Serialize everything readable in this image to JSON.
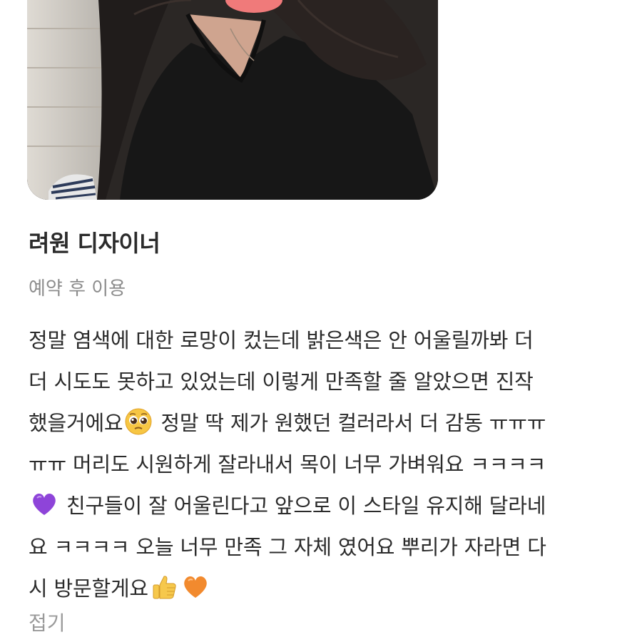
{
  "designer": {
    "name": "려원 디자이너",
    "visit_type": "예약 후 이용"
  },
  "review": {
    "lines": [
      "정말 염색에 대한 로망이 컸는데 밝은색은 안 어울릴까봐 더",
      "더 시도도 못하고 있었는데 이렇게 만족할 줄 알았으면 진작",
      [
        "했을거에요",
        " 정말 딱 제가 원했던 컬러라서 더 감동 ㅠㅠㅠ"
      ],
      "ㅠㅠ 머리도 시원하게 잘라내서 목이 너무 가벼워요 ㅋㅋㅋㅋ",
      " 친구들이 잘 어울린다고 앞으로 이 스타일 유지해 달라네",
      "요 ㅋㅋㅋㅋ 오늘 너무 만족 그 자체 였어요 뿌리가 자라면 다",
      "시 방문할게요"
    ],
    "emojis": [
      "pleading-face-icon",
      "purple-heart-icon",
      "thumbs-up-icon",
      "orange-heart-icon"
    ]
  },
  "fold_label": "접기",
  "colors": {
    "text": "#2b2b2b",
    "muted": "#8c8c8c",
    "fold": "#9a9a9a",
    "purple_heart": "#8e44d9",
    "orange_heart": "#f28a2e"
  }
}
